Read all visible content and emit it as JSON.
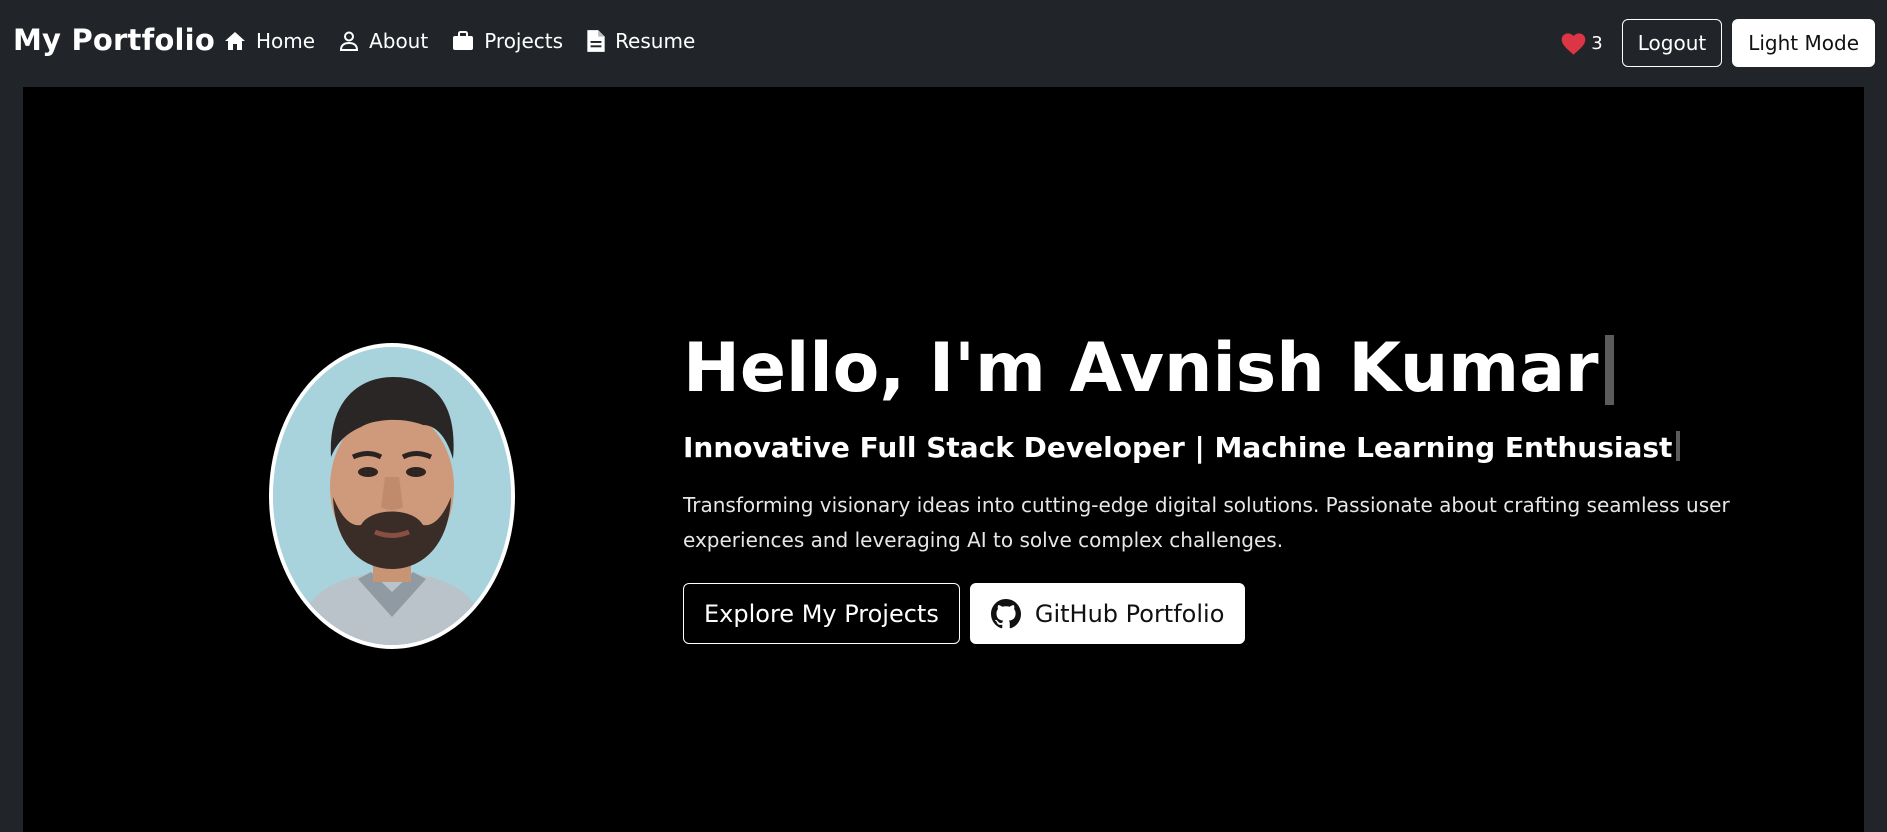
{
  "navbar": {
    "brand": "My Portfolio",
    "links": [
      {
        "label": "Home",
        "icon": "home-icon"
      },
      {
        "label": "About",
        "icon": "person-icon"
      },
      {
        "label": "Projects",
        "icon": "briefcase-icon"
      },
      {
        "label": "Resume",
        "icon": "document-icon"
      }
    ],
    "likes_count": "3",
    "logout_label": "Logout",
    "theme_toggle_label": "Light Mode"
  },
  "hero": {
    "headline": "Hello, I'm Avnish Kumar",
    "subtitle": "Innovative Full Stack Developer | Machine Learning Enthusiast",
    "description": "Transforming visionary ideas into cutting-edge digital solutions. Passionate about crafting seamless user experiences and leveraging AI to solve complex challenges.",
    "primary_cta": "Explore My Projects",
    "secondary_cta": "GitHub Portfolio"
  },
  "colors": {
    "navbar_bg": "#212529",
    "hero_bg": "#000000",
    "heart": "#dc3545",
    "text": "#ffffff"
  }
}
